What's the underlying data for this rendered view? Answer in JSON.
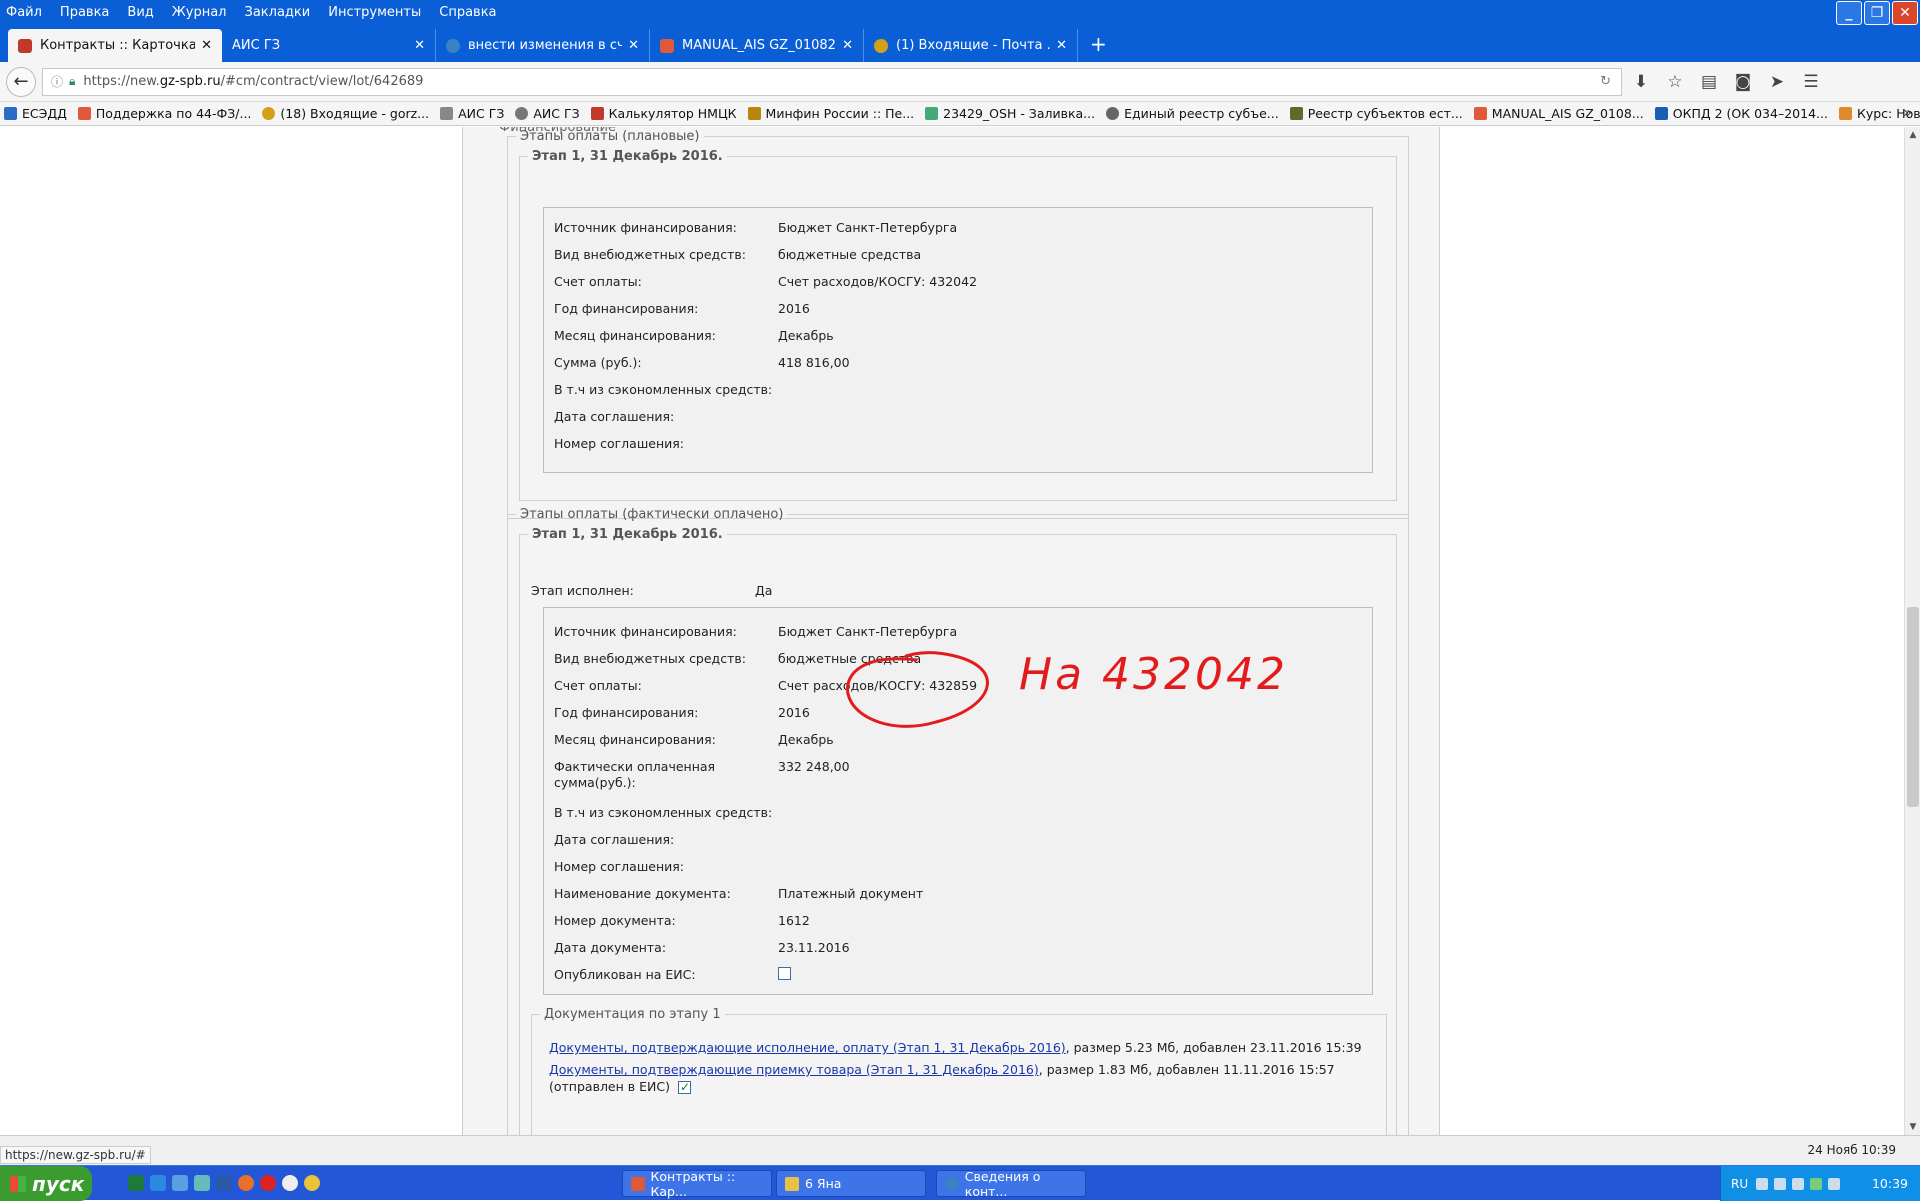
{
  "menu": [
    "Файл",
    "Правка",
    "Вид",
    "Журнал",
    "Закладки",
    "Инструменты",
    "Справка"
  ],
  "tabs": [
    {
      "label": "Контракты :: Карточка ...",
      "color": "#c0392b",
      "active": true
    },
    {
      "label": "АИС ГЗ",
      "color": "",
      "active": false
    },
    {
      "label": "внести изменения в сч...",
      "color": "#3b82c4",
      "active": false
    },
    {
      "label": "MANUAL_AIS GZ_01082...",
      "color": "#e05a3a",
      "active": false
    },
    {
      "label": "(1) Входящие - Почта ...",
      "color": "#d4a017",
      "active": false
    }
  ],
  "new_tab": "+",
  "url": {
    "prefix": "https://new.",
    "host": "gz-spb.ru",
    "path": "/#cm/contract/view/lot/642689"
  },
  "bookmarks": [
    {
      "label": "ЕСЭДД",
      "color": "#2b6cc4"
    },
    {
      "label": "Поддержка по 44-ФЗ/...",
      "color": "#e05a3a"
    },
    {
      "label": "(18) Входящие - gorz...",
      "color": "#d4a017"
    },
    {
      "label": "АИС ГЗ",
      "color": "#888888"
    },
    {
      "label": "АИС ГЗ",
      "color": "#777777"
    },
    {
      "label": "Калькулятор НМЦК",
      "color": "#c0392b"
    },
    {
      "label": "Минфин России :: Пе...",
      "color": "#b8860b"
    },
    {
      "label": "23429_OSH - Заливка...",
      "color": "#4a7"
    },
    {
      "label": "Единый реестр субъе...",
      "color": "#666"
    },
    {
      "label": "Реестр субъектов ест...",
      "color": "#5a6b2a"
    },
    {
      "label": "MANUAL_AIS GZ_0108...",
      "color": "#e05a3a"
    },
    {
      "label": "ОКПД 2 (ОК 034–2014...",
      "color": "#1a5fb4"
    },
    {
      "label": "Курс: Новая платфор...",
      "color": "#e08a2a"
    }
  ],
  "page": {
    "cut_title": "Финансирование",
    "planned": {
      "legend": "Этапы оплаты (плановые)",
      "stage_legend": "Этап 1, 31 Декабрь 2016.",
      "rows": [
        {
          "label": "Источник финансирования:",
          "value": "Бюджет Санкт-Петербурга"
        },
        {
          "label": "Вид внебюджетных средств:",
          "value": "бюджетные средства"
        },
        {
          "label": "Счет оплаты:",
          "value": "Счет расходов/КОСГУ: 432042"
        },
        {
          "label": "Год финансирования:",
          "value": "2016"
        },
        {
          "label": "Месяц финансирования:",
          "value": "Декабрь"
        },
        {
          "label": "Сумма (руб.):",
          "value": "418 816,00"
        },
        {
          "label": "В т.ч из сэкономленных средств:",
          "value": ""
        },
        {
          "label": "Дата соглашения:",
          "value": ""
        },
        {
          "label": "Номер соглашения:",
          "value": ""
        }
      ]
    },
    "actual": {
      "legend": "Этапы оплаты (фактически оплачено)",
      "stage_legend": "Этап 1, 31 Декабрь 2016.",
      "done_label": "Этап исполнен:",
      "done_value": "Да",
      "rows": [
        {
          "label": "Источник финансирования:",
          "value": "Бюджет Санкт-Петербурга"
        },
        {
          "label": "Вид внебюджетных средств:",
          "value": "бюджетные средства"
        },
        {
          "label": "Счет оплаты:",
          "value": "Счет расходов/КОСГУ: 432859"
        },
        {
          "label": "Год финансирования:",
          "value": "2016"
        },
        {
          "label": "Месяц финансирования:",
          "value": "Декабрь"
        },
        {
          "label": "Фактически оплаченная сумма(руб.):",
          "value": "332 248,00"
        },
        {
          "label": "В т.ч из сэкономленных средств:",
          "value": ""
        },
        {
          "label": "Дата соглашения:",
          "value": ""
        },
        {
          "label": "Номер соглашения:",
          "value": ""
        },
        {
          "label": "Наименование документа:",
          "value": "Платежный документ"
        },
        {
          "label": "Номер документа:",
          "value": "1612"
        },
        {
          "label": "Дата документа:",
          "value": "23.11.2016"
        }
      ],
      "published_label": "Опубликован на ЕИС:",
      "published_checked": false
    },
    "docs": {
      "legend": "Документация по этапу 1",
      "items": [
        {
          "link": "Документы, подтверждающие исполнение, оплату (Этап 1, 31 Декабрь 2016)",
          "info": ", размер 5.23 Мб, добавлен 23.11.2016 15:39",
          "suffix": "",
          "checked": false
        },
        {
          "link": "Документы, подтверждающие приемку товара (Этап 1, 31 Декабрь 2016)",
          "info": ", размер 1.83 Мб, добавлен 11.11.2016 15:57 (отправлен в ЕИС)",
          "suffix": "",
          "checked": true
        }
      ]
    },
    "annotation": {
      "text": "На 432042",
      "color": "#e21c1c"
    }
  },
  "status": {
    "url": "https://new.gz-spb.ru/#",
    "date": "24 Нояб 10:39"
  },
  "taskbar": {
    "start": "пуск",
    "tasks": [
      {
        "label": "Контракты :: Кар...",
        "color": "#e05a3a"
      },
      {
        "label": "6 Яна",
        "color": "#e8c04a"
      },
      {
        "label": "Сведения о конт...",
        "color": "#3b82c4"
      }
    ],
    "lang": "RU",
    "clock": "10:39"
  }
}
